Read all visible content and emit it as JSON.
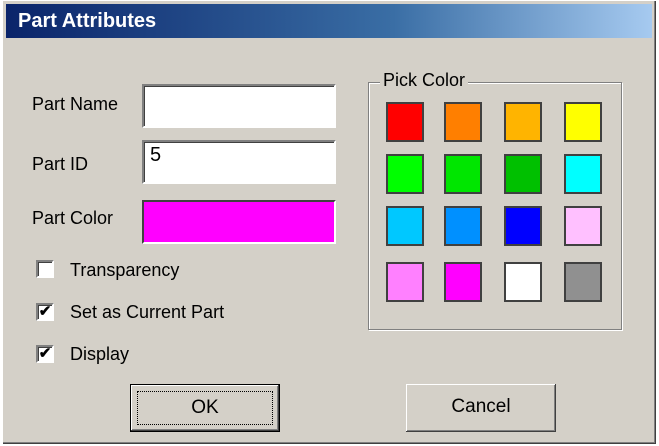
{
  "window": {
    "title": "Part Attributes"
  },
  "form": {
    "part_name_label": "Part Name",
    "part_name_value": "",
    "part_id_label": "Part ID",
    "part_id_value": "5",
    "part_color_label": "Part Color",
    "part_color_value": "#ff00ff"
  },
  "checkboxes": [
    {
      "label": "Transparency",
      "checked": false
    },
    {
      "label": "Set as Current Part",
      "checked": true
    },
    {
      "label": "Display",
      "checked": true
    }
  ],
  "picker": {
    "legend": "Pick Color",
    "swatches": [
      "#ff0000",
      "#ff7f00",
      "#ffb400",
      "#ffff00",
      "#00ff00",
      "#00e600",
      "#00c000",
      "#00ffff",
      "#00c8ff",
      "#0090ff",
      "#0000ff",
      "#ffc0ff",
      "#ff80ff",
      "#ff00ff",
      "#ffffff",
      "#909090"
    ]
  },
  "buttons": {
    "ok": "OK",
    "cancel": "Cancel"
  }
}
